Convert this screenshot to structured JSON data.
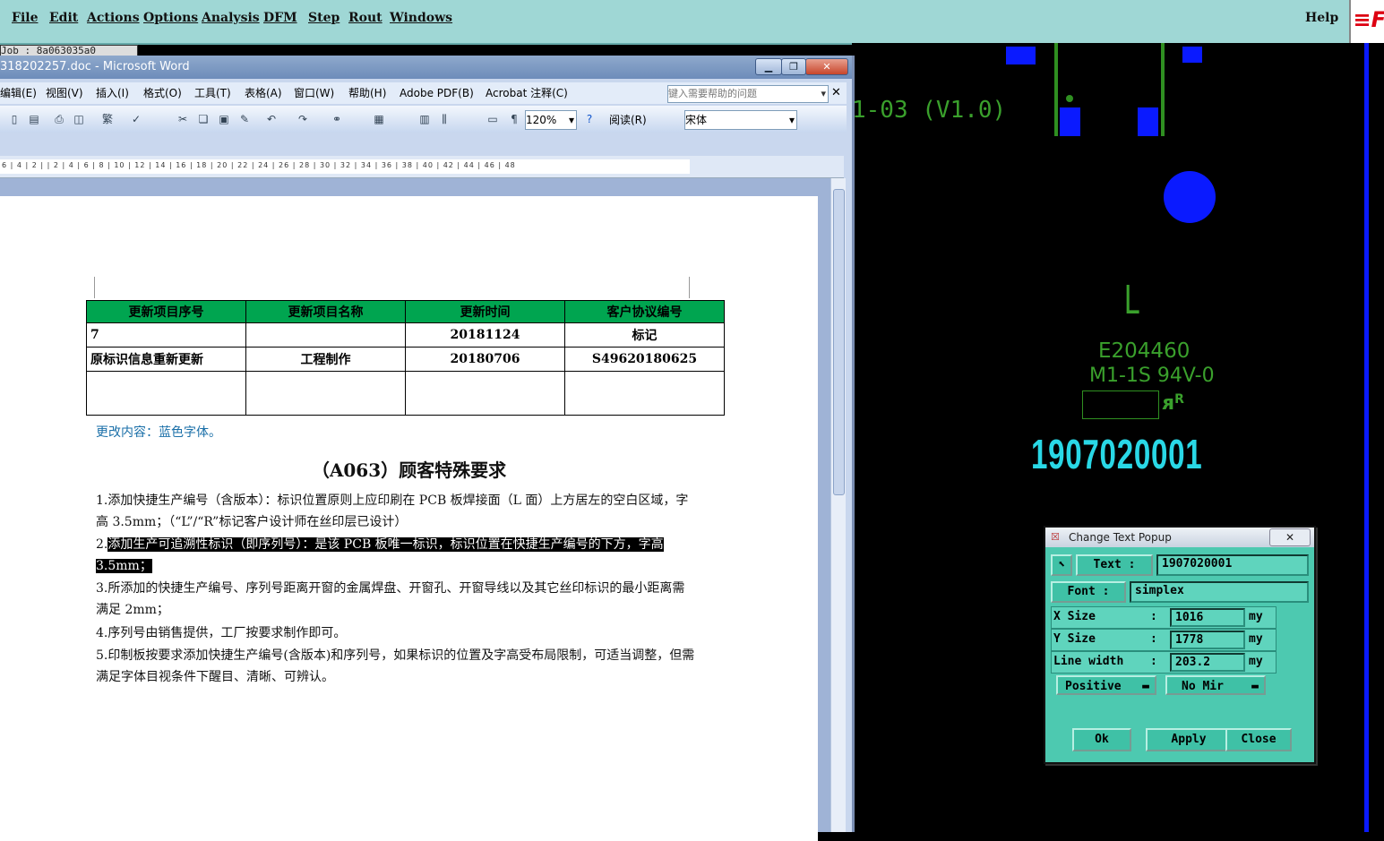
{
  "cad": {
    "menu": [
      "File",
      "Edit",
      "Actions",
      "Options",
      "Analysis",
      "DFM",
      "Step",
      "Rout",
      "Windows"
    ],
    "help_label": "Help",
    "job_strip": "Job : 8a063035a0",
    "canvas": {
      "version_text": "1-03 (V1.0)",
      "layer_letter": "L",
      "ul_code": "E204460",
      "ul_grade": "M1-1S 94V-0",
      "ul_logo": "R",
      "serial_number": "1907020001",
      "colors": {
        "pad": "#0a1aff",
        "silk": "#3aa02c",
        "text": "#29d8e6"
      }
    }
  },
  "word": {
    "title": "318202257.doc - Microsoft Word",
    "menu": [
      "编辑(E)",
      "视图(V)",
      "插入(I)",
      "格式(O)",
      "工具(T)",
      "表格(A)",
      "窗口(W)",
      "帮助(H)",
      "Adobe PDF(B)",
      "Acrobat 注释(C)"
    ],
    "help_placeholder": "键入需要帮助的问题",
    "zoom": "120%",
    "read_button": "阅读(R)",
    "font_name": "宋体",
    "ruler_text": "6 | 4 | 2 | | 2 | 4 | 6 | 8 | 10 | 12 | 14 | 16 | 18 | 20 | 22 | 24 | 26 | 28 | 30 | 32 | 34 | 36 | 38 | 40 | 42 | 44 | 46 | 48",
    "table": {
      "headers": [
        "更新项目序号",
        "更新项目名称",
        "更新时间",
        "客户协议编号"
      ],
      "rows": [
        [
          "7",
          "",
          "20181124",
          "标记"
        ],
        [
          "原标识信息重新更新",
          "工程制作",
          "20180706",
          "S49620180625"
        ],
        [
          "",
          "",
          "",
          ""
        ]
      ]
    },
    "blue_note": "更改内容：蓝色字体。",
    "heading": "（A063）顾客特殊要求",
    "items": [
      "1.添加快捷生产编号（含版本）：标识位置原则上应印刷在 PCB 板焊接面（L 面）上方居左的空白区域，字高 3.5mm；（“L”/“R”标记客户设计师在丝印层已设计）",
      "3.所添加的快捷生产编号、序列号距离开窗的金属焊盘、开窗孔、开窗导线以及其它丝印标识的最小距离需满足 2mm；",
      "4.序列号由销售提供，工厂按要求制作即可。",
      "5.印制板按要求添加快捷生产编号(含版本)和序列号，如果标识的位置及字高受布局限制，可适当调整，但需满足字体目视条件下醒目、清晰、可辨认。"
    ],
    "item2_prefix": "2.",
    "item2_highlight": "添加生产可追溯性标识（即序列号）：是该 PCB 板唯一标识，标识位置在快捷生产编号的下方，字高 3.5mm；"
  },
  "popup": {
    "title": "Change Text Popup",
    "text_label": "Text :",
    "text_value": "1907020001",
    "font_label": "Font :",
    "font_value": "simplex",
    "x_label": "X Size",
    "x_value": "1016",
    "y_label": "Y Size",
    "y_value": "1778",
    "lw_label": "Line width",
    "lw_value": "203.2",
    "unit": "my",
    "polarity": "Positive",
    "mirror": "No Mir",
    "ok": "Ok",
    "apply": "Apply",
    "close": "Close"
  }
}
